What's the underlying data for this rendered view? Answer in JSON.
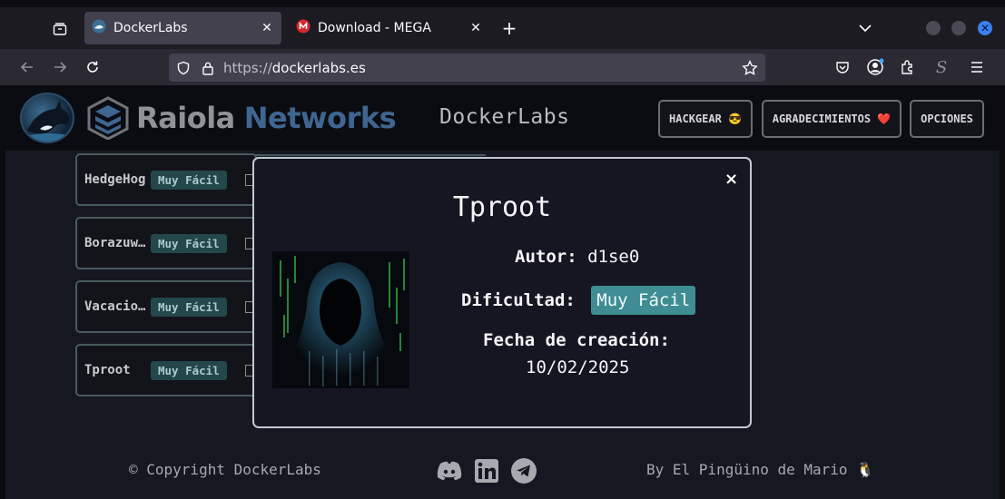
{
  "browser": {
    "tabs": [
      {
        "title": "DockerLabs",
        "active": true
      },
      {
        "title": "Download - MEGA",
        "active": false
      }
    ],
    "url_scheme": "https://",
    "url_host": "dockerlabs.es",
    "new_tab_symbol": "+",
    "tab_close_symbol": "✕",
    "window_close_symbol": "✕"
  },
  "header": {
    "brand_word1": "Raiola",
    "brand_word2": "Networks",
    "site_title": "DockerLabs",
    "buttons": [
      "HACKGEAR 😎",
      "AGRADECIMIENTOS ❤️",
      "OPCIONES"
    ]
  },
  "machines": [
    {
      "name": "HedgeHog",
      "difficulty": "Muy Fácil"
    },
    {
      "name": "Borazuwarah",
      "difficulty": "Muy Fácil"
    },
    {
      "name": "Vacaciones",
      "difficulty": "Muy Fácil"
    },
    {
      "name": "Tproot",
      "difficulty": "Muy Fácil"
    }
  ],
  "modal": {
    "title": "Tproot",
    "author_label": "Autor:",
    "author_value": "d1se0",
    "difficulty_label": "Dificultad:",
    "difficulty_value": "Muy Fácil",
    "date_label": "Fecha de creación:",
    "date_value": "10/02/2025",
    "close_symbol": "×"
  },
  "footer": {
    "copyright": "© Copyright DockerLabs",
    "credit": "By El Pingüino de Mario 🐧",
    "social_icons": [
      "discord-icon",
      "linkedin-icon",
      "telegram-icon"
    ]
  },
  "colors": {
    "accent_badge": "#3f8d93",
    "brand_blue": "#3e6690",
    "window_close": "#3b7ff2"
  }
}
